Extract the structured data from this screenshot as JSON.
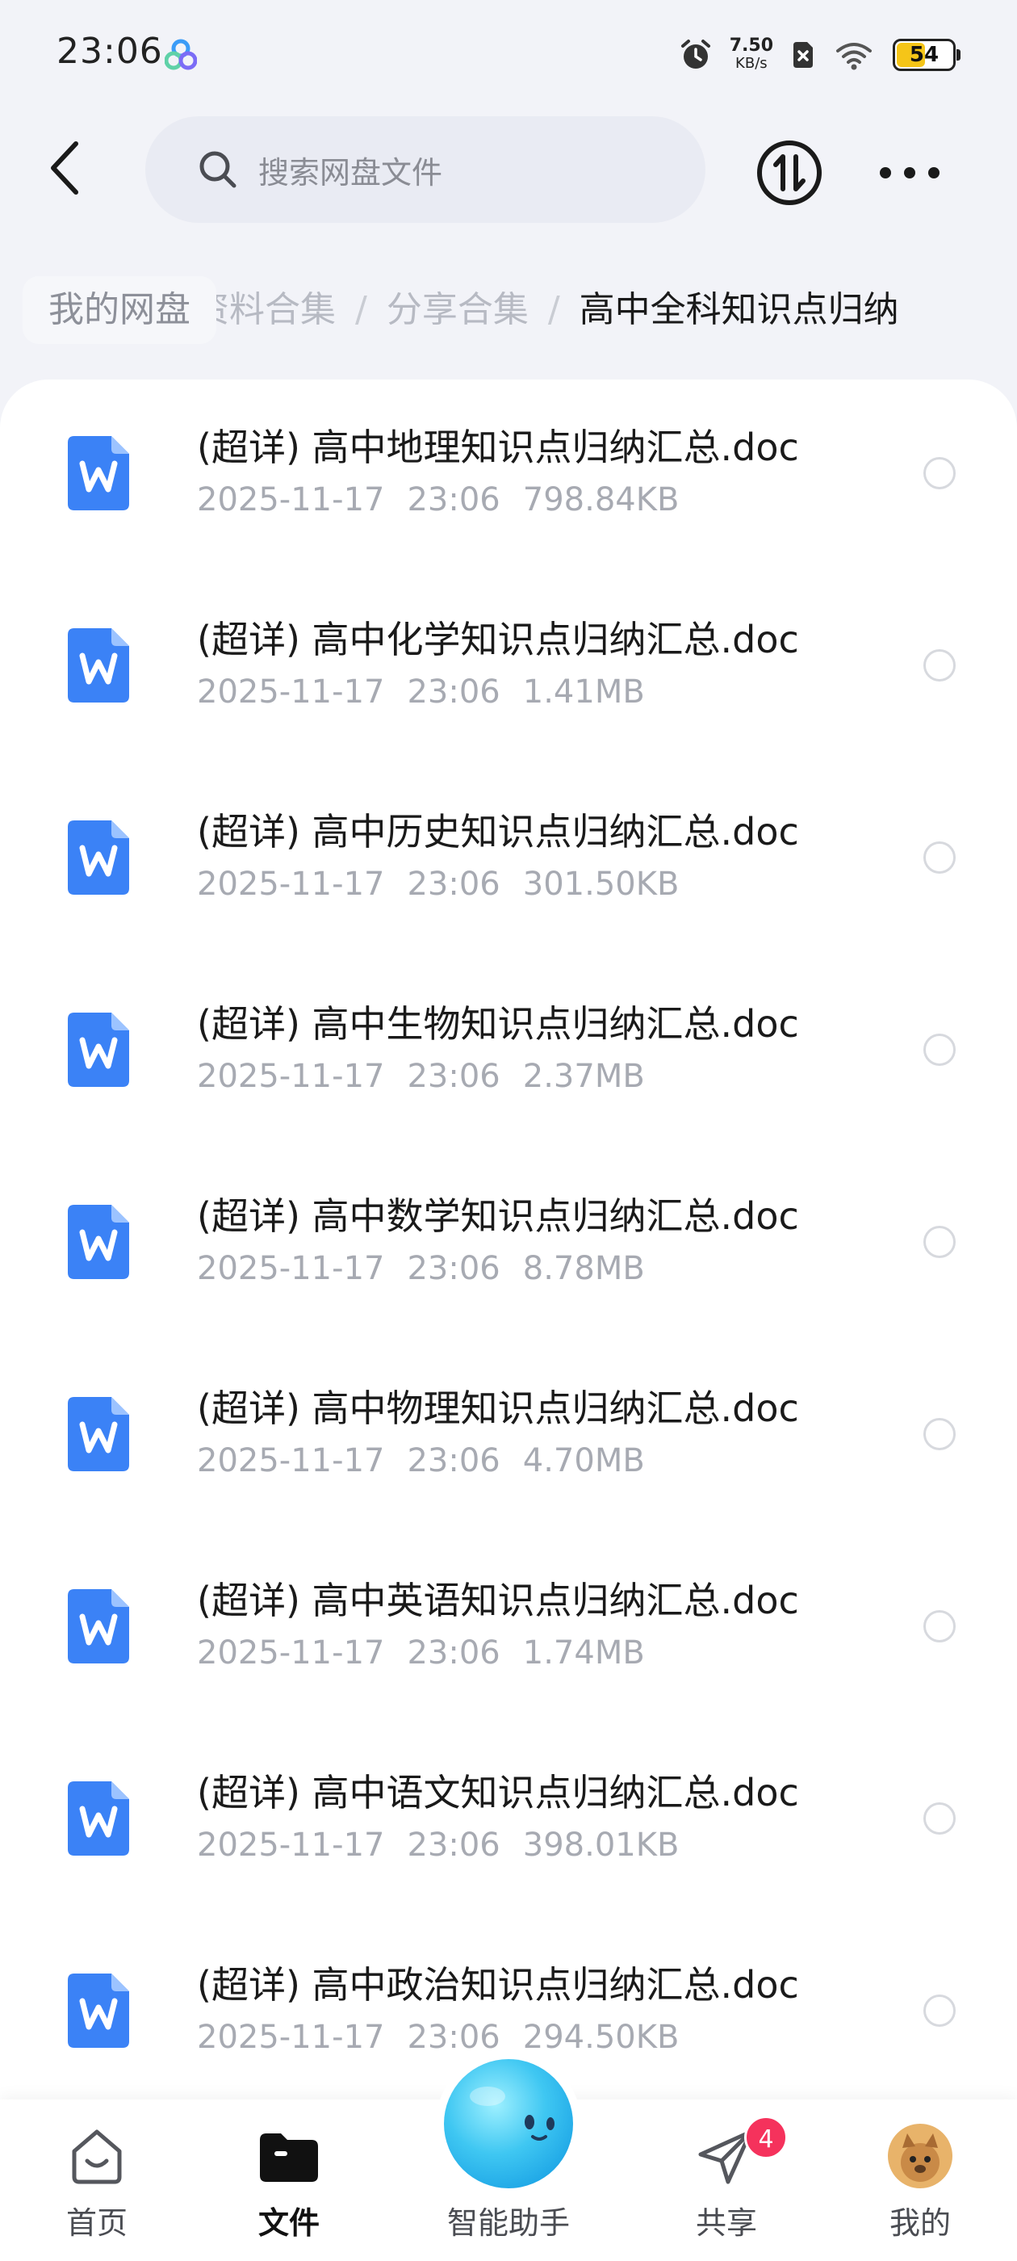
{
  "status_bar": {
    "time": "23:06",
    "net_speed_value": "7.50",
    "net_speed_unit": "KB/s",
    "battery_level": "54",
    "battery_fraction": 0.54,
    "battery_color": "#f5c518"
  },
  "header": {
    "search_placeholder": "搜索网盘文件"
  },
  "breadcrumb": {
    "home": "我的网盘",
    "parents": [
      "资料合集",
      "分享合集"
    ],
    "separator": "/",
    "current": "高中全科知识点归纳"
  },
  "files": [
    {
      "name": "(超详) 高中地理知识点归纳汇总.doc",
      "date": "2025-11-17",
      "time": "23:06",
      "size": "798.84KB"
    },
    {
      "name": "(超详) 高中化学知识点归纳汇总.doc",
      "date": "2025-11-17",
      "time": "23:06",
      "size": "1.41MB"
    },
    {
      "name": "(超详) 高中历史知识点归纳汇总.doc",
      "date": "2025-11-17",
      "time": "23:06",
      "size": "301.50KB"
    },
    {
      "name": "(超详) 高中生物知识点归纳汇总.doc",
      "date": "2025-11-17",
      "time": "23:06",
      "size": "2.37MB"
    },
    {
      "name": "(超详) 高中数学知识点归纳汇总.doc",
      "date": "2025-11-17",
      "time": "23:06",
      "size": "8.78MB"
    },
    {
      "name": "(超详) 高中物理知识点归纳汇总.doc",
      "date": "2025-11-17",
      "time": "23:06",
      "size": "4.70MB"
    },
    {
      "name": "(超详) 高中英语知识点归纳汇总.doc",
      "date": "2025-11-17",
      "time": "23:06",
      "size": "1.74MB"
    },
    {
      "name": "(超详) 高中语文知识点归纳汇总.doc",
      "date": "2025-11-17",
      "time": "23:06",
      "size": "398.01KB"
    },
    {
      "name": "(超详) 高中政治知识点归纳汇总.doc",
      "date": "2025-11-17",
      "time": "23:06",
      "size": "294.50KB"
    }
  ],
  "file_icon": {
    "name": "word-doc-icon",
    "color": "#3b82f6"
  },
  "bottom_nav": {
    "items": [
      {
        "label": "首页",
        "icon": "home-icon"
      },
      {
        "label": "文件",
        "icon": "folder-icon",
        "active": true
      },
      {
        "label": "智能助手",
        "icon": "assistant-orb-icon"
      },
      {
        "label": "共享",
        "icon": "paper-plane-icon",
        "badge": "4"
      },
      {
        "label": "我的",
        "icon": "avatar"
      }
    ],
    "badge_color": "#f5325c",
    "assistant_color": "#3fc7f2"
  }
}
